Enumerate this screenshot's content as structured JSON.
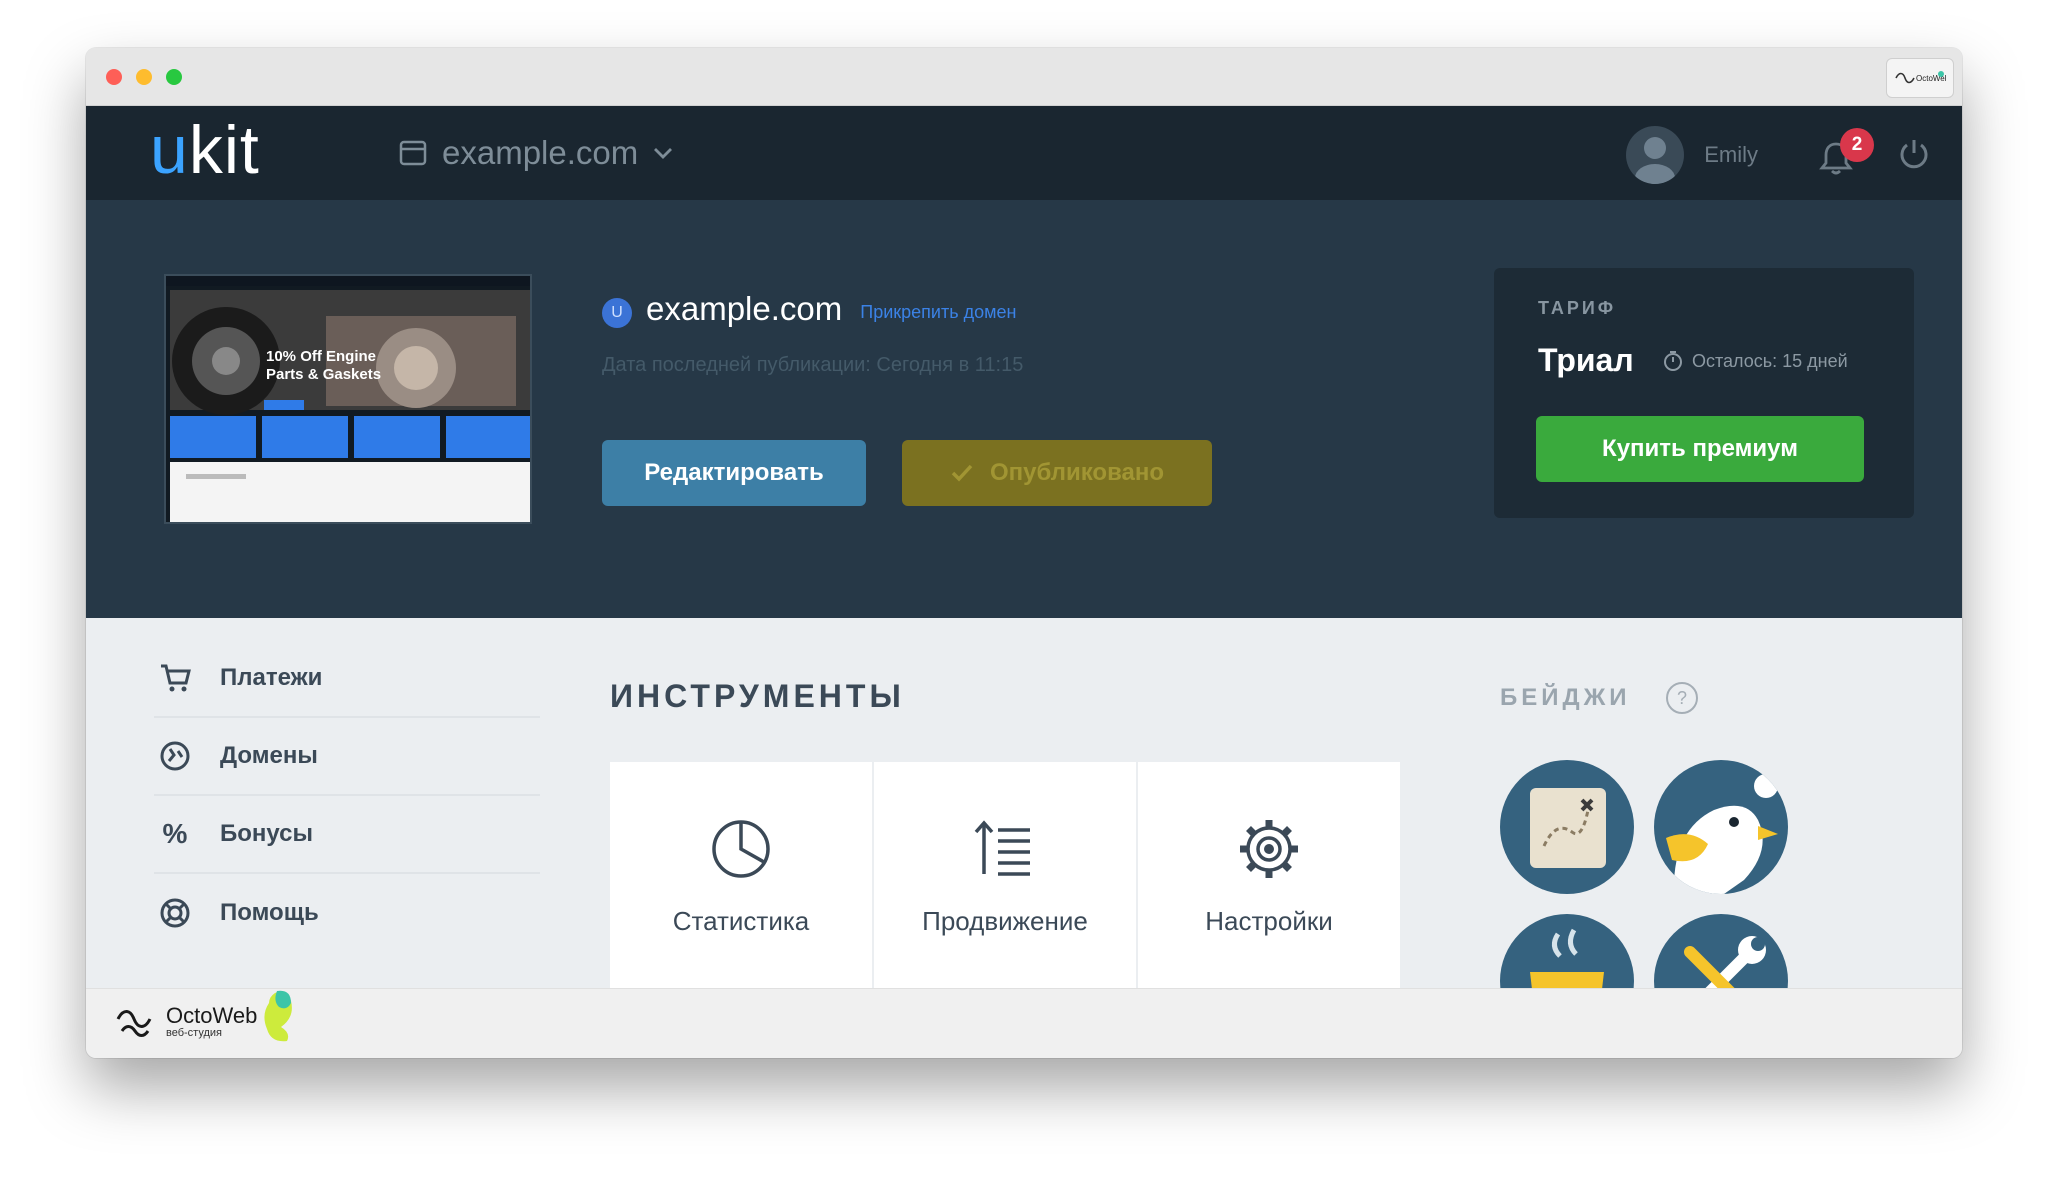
{
  "header": {
    "logo_u": "u",
    "logo_rest": "kit",
    "site_selector": "example.com",
    "user_name": "Emily",
    "notification_count": "2"
  },
  "site": {
    "icon_letter": "U",
    "title": "example.com",
    "attach_domain": "Прикрепить домен",
    "publish_date": "Дата последней публикации: Сегодня в 11:15",
    "thumbnail_headline": "10% Off Engine Parts & Gaskets",
    "edit_button": "Редактировать",
    "published_button": "Опубликовано"
  },
  "plan": {
    "label": "ТАРИФ",
    "name": "Триал",
    "remaining": "Осталось: 15 дней",
    "buy_button": "Купить премиум"
  },
  "sidebar": {
    "items": [
      {
        "label": "Платежи",
        "icon": "cart-icon"
      },
      {
        "label": "Домены",
        "icon": "domain-icon"
      },
      {
        "label": "Бонусы",
        "icon": "percent-icon"
      },
      {
        "label": "Помощь",
        "icon": "lifebuoy-icon"
      }
    ]
  },
  "tools": {
    "title": "ИНСТРУМЕНТЫ",
    "items": [
      {
        "label": "Статистика",
        "icon": "pie-chart-icon"
      },
      {
        "label": "Продвижение",
        "icon": "promotion-icon"
      },
      {
        "label": "Настройки",
        "icon": "gear-icon"
      }
    ]
  },
  "badges": {
    "title": "БЕЙДЖИ",
    "help": "?"
  },
  "footer": {
    "brand": "OctoWeb",
    "subtitle": "веб-студия"
  },
  "colors": {
    "header_bg": "#1a2630",
    "hero_bg": "#263847",
    "accent_blue": "#3d7fa6",
    "premium_green": "#3aaa3d",
    "published_olive": "#7b7120",
    "badge_circle": "#35627f"
  }
}
